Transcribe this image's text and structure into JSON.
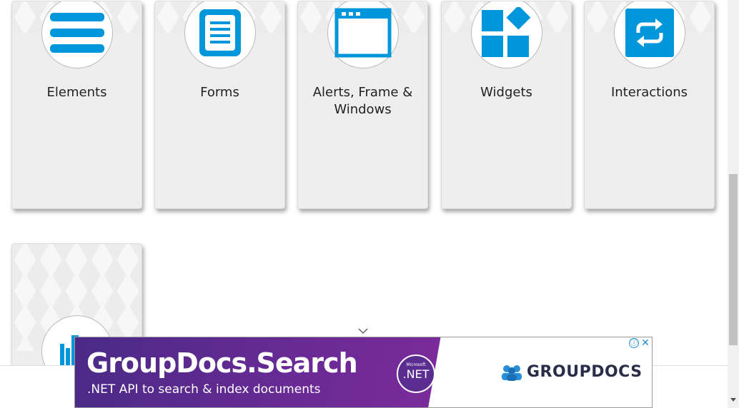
{
  "cards": [
    {
      "label": "Elements",
      "icon": "menu-lines-icon"
    },
    {
      "label": "Forms",
      "icon": "document-form-icon"
    },
    {
      "label": "Alerts, Frame & Windows",
      "icon": "browser-window-icon"
    },
    {
      "label": "Widgets",
      "icon": "widgets-grid-icon"
    },
    {
      "label": "Interactions",
      "icon": "swap-arrows-icon"
    },
    {
      "label": "",
      "icon": "bookshelf-icon"
    }
  ],
  "colors": {
    "accent": "#0096dc",
    "card_bg": "#eeeeee",
    "ad_purple": "#6a2a96"
  },
  "ad": {
    "title": "GroupDocs.Search",
    "subtitle": ".NET API to search & index documents",
    "badge_small": "Microsoft",
    "badge_large": ".NET",
    "brand": "GROUPDOCS",
    "info_symbol": "ⓘ",
    "close_symbol": "✕"
  }
}
